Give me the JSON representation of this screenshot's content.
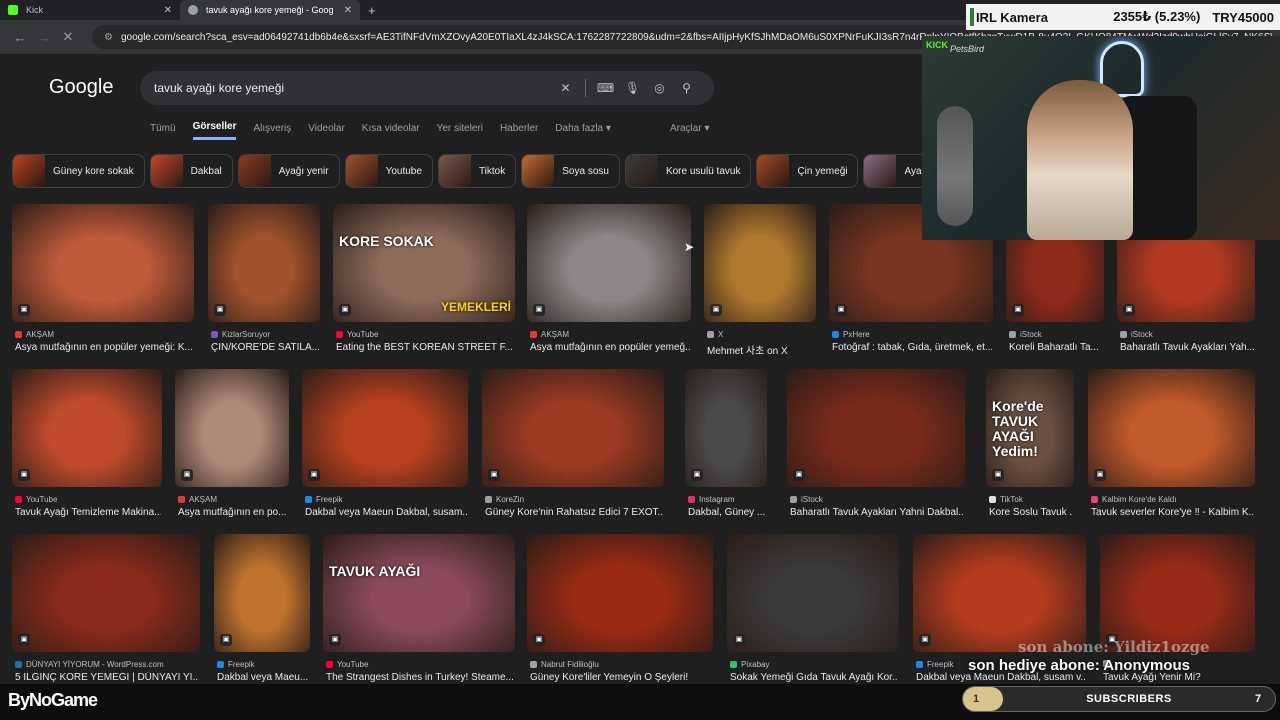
{
  "browser": {
    "tabs": [
      {
        "title": "Kick",
        "color": "#53fc18",
        "active": false
      },
      {
        "title": "tavuk ayağı kore yemeği - Goog",
        "color": "#9aa0a6",
        "active": true
      }
    ],
    "url": "google.com/search?sca_esv=ad06492741db6b4e&sxsrf=AE3TifNFdVmXZOvyA20E0TIaXL4zJ4kSCA:1762287722809&udm=2&fbs=AIIjpHyKfSJhMDaOM6uS0XPNrFuKJI3sR7n4rRnlpYIOBctfKhzgTxwD1B-8u4O3L GKHQ84TMwWd2Izd0wbHaiGLlSv7_NK6SW",
    "url_icon": "tune-icon"
  },
  "google": {
    "logo": "Google",
    "query": "tavuk ayağı kore yemeği",
    "tabs": [
      "Tümü",
      "Görseller",
      "Alışveriş",
      "Videolar",
      "Kısa videolar",
      "Yer siteleri",
      "Haberler",
      "Daha fazla ▾"
    ],
    "tools": "Araçlar ▾",
    "chips": [
      {
        "label": "Güney kore sokak",
        "color": "#b8441f"
      },
      {
        "label": "Dakbal",
        "color": "#c7472a"
      },
      {
        "label": "Ayağı yenir",
        "color": "#8d3a22"
      },
      {
        "label": "Youtube",
        "color": "#a6502c"
      },
      {
        "label": "Tiktok",
        "color": "#7a5a4e"
      },
      {
        "label": "Soya sosu",
        "color": "#c76b2e"
      },
      {
        "label": "Kore usulü tavuk",
        "color": "#3b3b3b"
      },
      {
        "label": "Çin yemeği",
        "color": "#a34a26"
      },
      {
        "label": "Ayağı nas",
        "color": "#8a6e82"
      }
    ],
    "results": [
      {
        "src": "AKŞAM",
        "srcColor": "#e53935",
        "cap": "Asya mutfağının en popüler yemeği: K...",
        "color": "#c05a3a"
      },
      {
        "src": "KizlarSoruyor",
        "srcColor": "#7e57c2",
        "cap": "ÇİN/KORE'DE SATILA...",
        "color": "#a0522d"
      },
      {
        "src": "YouTube",
        "srcColor": "#ff0033",
        "cap": "Eating the BEST KOREAN STREET F...",
        "color": "#8c6b5a",
        "overlay": "KORE SOKAK",
        "overlay2": "YEMEKLERİ"
      },
      {
        "src": "AKŞAM",
        "srcColor": "#e53935",
        "cap": "Asya mutfağının en popüler yemeğ...",
        "color": "#8a8786"
      },
      {
        "src": "X",
        "srcColor": "#9aa0a6",
        "cap": "Mehmet 사초 on X",
        "color": "#b07a2e"
      },
      {
        "src": "PxHere",
        "srcColor": "#1e88e5",
        "cap": "Fotoğraf : tabak, Gıda, üretmek, et...",
        "color": "#7a3520"
      },
      {
        "src": "iStock",
        "srcColor": "#9aa0a6",
        "cap": "Koreli Baharatlı Ta...",
        "color": "#8e2a1a"
      },
      {
        "src": "iStock",
        "srcColor": "#9aa0a6",
        "cap": "Baharatlı Tavuk Ayakları Yah...",
        "color": "#b23a22"
      },
      {
        "src": "YouTube",
        "srcColor": "#ff0033",
        "cap": "Tavuk Ayağı Temizleme Makina...",
        "color": "#c04b2c"
      },
      {
        "src": "AKŞAM",
        "srcColor": "#e53935",
        "cap": "Asya mutfağının en po...",
        "color": "#b08a78"
      },
      {
        "src": "Freepik",
        "srcColor": "#1e88e5",
        "cap": "Dakbal veya Maeun Dakbal, susam...",
        "color": "#b7411f"
      },
      {
        "src": "KoreZin",
        "srcColor": "#9aa0a6",
        "cap": "Güney Kore'nin Rahatsız Edici 7 EXOT...",
        "color": "#9c3a22"
      },
      {
        "src": "Instagram",
        "srcColor": "#e1306c",
        "cap": "Dakbal, Güney ...",
        "color": "#4a4a4a"
      },
      {
        "src": "iStock",
        "srcColor": "#9aa0a6",
        "cap": "Baharatlı Tavuk Ayakları Yahni Dakbal...",
        "color": "#7a2a1a"
      },
      {
        "src": "TikTok",
        "srcColor": "#e0e0e0",
        "cap": "Kore Soslu Tavuk ...",
        "color": "#6a5040",
        "overlay": "Kore'de TAVUK AYAĞI Yedim!"
      },
      {
        "src": "Kalbim Kore'de Kaldı",
        "srcColor": "#ec407a",
        "cap": "Tavuk severler Kore'ye ‼ - Kalbim K...",
        "color": "#c25a2a"
      },
      {
        "src": "DÜNYAYI YİYORUM - WordPress.com",
        "srcColor": "#21759b",
        "cap": "5 İLGİNÇ KORE YEMEĞİ | DÜNYAYI Yİ...",
        "color": "#8a2a1a"
      },
      {
        "src": "Freepik",
        "srcColor": "#1e88e5",
        "cap": "Dakbal veya Maeu...",
        "color": "#c0732e"
      },
      {
        "src": "YouTube",
        "srcColor": "#ff0033",
        "cap": "The Strangest Dishes in Turkey! Steame...",
        "color": "#8a4a5a",
        "overlay": "TAVUK AYAĞI"
      },
      {
        "src": "Nabrut Fidilioğlu",
        "srcColor": "#9aa0a6",
        "cap": "Güney Kore'liler Yemeyin O Şeyleri!",
        "color": "#9a2a14"
      },
      {
        "src": "Pixabay",
        "srcColor": "#2ec66d",
        "cap": "Sokak Yemeği Gıda Tavuk Ayağı Kor...",
        "color": "#3a3a3a"
      },
      {
        "src": "Freepik",
        "srcColor": "#1e88e5",
        "cap": "Dakbal veya Maeun Dakbal, susam v...",
        "color": "#b53c1e"
      },
      {
        "src": "",
        "srcColor": "#9aa0a6",
        "cap": "Tavuk Ayağı Yenir Mi?",
        "color": "#9a2a18"
      }
    ]
  },
  "stream": {
    "ticker_label": "IRL Kamera",
    "ticker_price": "2355₺ (5.23%)",
    "ticker_symbol": "TRY45000",
    "cam_brand": "KICK",
    "cam_name": "PetsBird",
    "alert_top": "son abone: Yildiz1ozge",
    "alert_main": "son hediye abone: Anonymous",
    "logo": "ByNoGame",
    "sub_count": "1",
    "sub_label": "SUBSCRIBERS",
    "sub_goal": "7"
  }
}
